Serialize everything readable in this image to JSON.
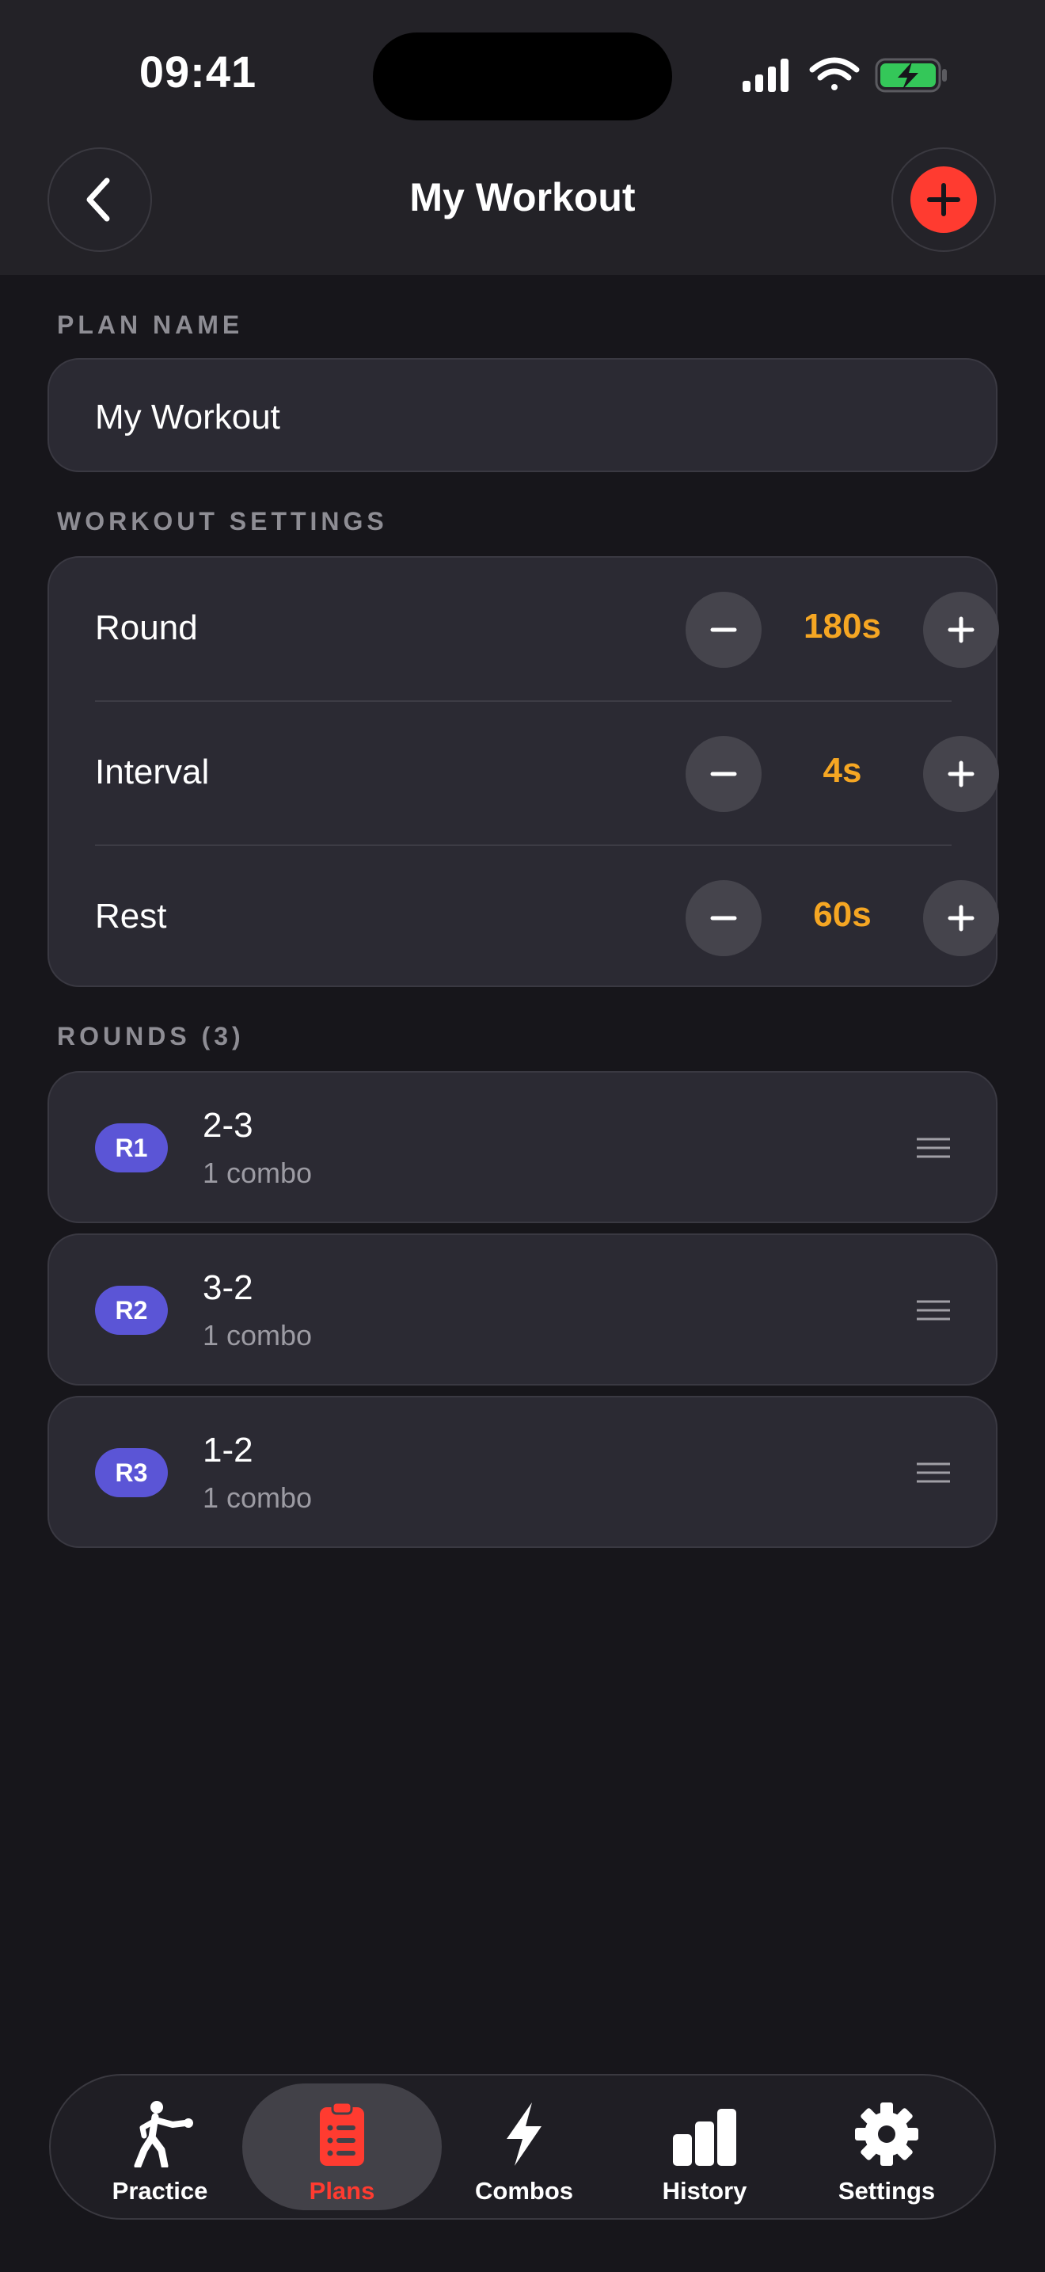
{
  "status_bar": {
    "time": "09:41"
  },
  "header": {
    "title": "My Workout"
  },
  "plan_name": {
    "label": "PLAN NAME",
    "value": "My Workout",
    "placeholder": ""
  },
  "workout_settings": {
    "label": "WORKOUT SETTINGS",
    "rows": [
      {
        "label": "Round",
        "value": "180s"
      },
      {
        "label": "Interval",
        "value": "4s"
      },
      {
        "label": "Rest",
        "value": "60s"
      }
    ]
  },
  "rounds": {
    "label": "ROUNDS (3)",
    "items": [
      {
        "badge": "R1",
        "title": "2-3",
        "subtitle": "1 combo"
      },
      {
        "badge": "R2",
        "title": "3-2",
        "subtitle": "1 combo"
      },
      {
        "badge": "R3",
        "title": "1-2",
        "subtitle": "1 combo"
      }
    ]
  },
  "tabbar": {
    "active": "Plans",
    "tabs": [
      {
        "label": "Practice",
        "icon": "boxer-icon"
      },
      {
        "label": "Plans",
        "icon": "clipboard-icon"
      },
      {
        "label": "Combos",
        "icon": "bolt-icon"
      },
      {
        "label": "History",
        "icon": "bar-chart-icon"
      },
      {
        "label": "Settings",
        "icon": "gear-icon"
      }
    ]
  },
  "colors": {
    "accent": "#ff3b30",
    "value": "#f5a623",
    "badge": "#5b55d6",
    "battery": "#34c759"
  }
}
